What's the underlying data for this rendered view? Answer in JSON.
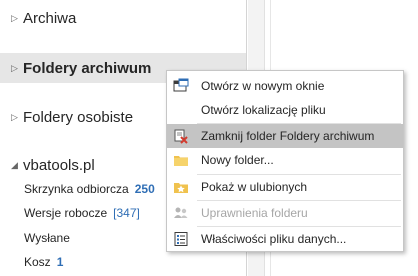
{
  "folder_pane": {
    "nodes": [
      {
        "label": "Archiwa"
      },
      {
        "label": "Foldery archiwum"
      },
      {
        "label": "Foldery osobiste"
      },
      {
        "label": "vbatools.pl"
      }
    ],
    "mailbox": [
      {
        "label": "Skrzynka odbiorcza",
        "count": "250"
      },
      {
        "label": "Wersje robocze",
        "count": "[347]"
      },
      {
        "label": "Wysłane",
        "count": ""
      },
      {
        "label": "Kosz",
        "count": "1"
      }
    ]
  },
  "context_menu": {
    "items": [
      {
        "label": "Otwórz w nowym oknie",
        "icon": "new-window-icon",
        "enabled": true
      },
      {
        "label": "Otwórz lokalizację pliku",
        "icon": "",
        "enabled": true
      },
      {
        "label": "Zamknij folder Foldery archiwum",
        "icon": "close-folder-icon",
        "enabled": true,
        "highlighted": true
      },
      {
        "label": "Nowy folder...",
        "icon": "folder-icon",
        "enabled": true
      },
      {
        "label": "Pokaż w ulubionych",
        "icon": "favorite-folder-icon",
        "enabled": true
      },
      {
        "label": "Uprawnienia folderu",
        "icon": "permissions-icon",
        "enabled": false
      },
      {
        "label": "Właściwości pliku danych...",
        "icon": "properties-icon",
        "enabled": true
      }
    ]
  },
  "colors": {
    "accent_count": "#2f6eb5",
    "menu_highlight": "#c4c4c4",
    "selected_row": "#e6e6e6"
  }
}
